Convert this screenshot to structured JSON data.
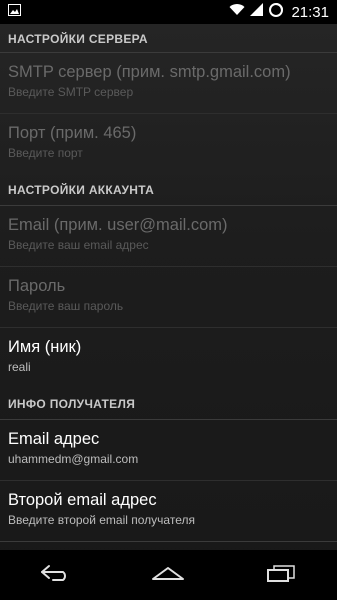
{
  "status_bar": {
    "time": "21:31",
    "icons": [
      "image-icon",
      "wifi-icon",
      "signal-icon",
      "battery-icon"
    ]
  },
  "sections": {
    "server": {
      "header": "НАСТРОЙКИ СЕРВЕРА",
      "smtp": {
        "title": "SMTP сервер (прим. smtp.gmail.com)",
        "summary": "Введите SMTP сервер"
      },
      "port": {
        "title": "Порт (прим. 465)",
        "summary": "Введите порт"
      }
    },
    "account": {
      "header": "НАСТРОЙКИ АККАУНТА",
      "email": {
        "title": "Email (прим. user@mail.com)",
        "summary": "Введите ваш email адрес"
      },
      "password": {
        "title": "Пароль",
        "summary": "Введите ваш пароль"
      },
      "nick": {
        "title": "Имя (ник)",
        "summary": "reali"
      }
    },
    "recipient": {
      "header": "ИНФО ПОЛУЧАТЕЛЯ",
      "email": {
        "title": "Email адрес",
        "summary": "uhammedm@gmail.com"
      },
      "second_email": {
        "title": "Второй email адрес",
        "summary": "Введите второй email получателя"
      }
    }
  },
  "nav_bar": {
    "icons": [
      "back-icon",
      "home-icon",
      "recent-apps-icon"
    ]
  },
  "colors": {
    "background": "#1d1d1d",
    "status_bar": "#000000",
    "header_text": "#c9c9c9",
    "enabled_title": "#ffffff",
    "disabled_title": "#6a6a6a"
  }
}
